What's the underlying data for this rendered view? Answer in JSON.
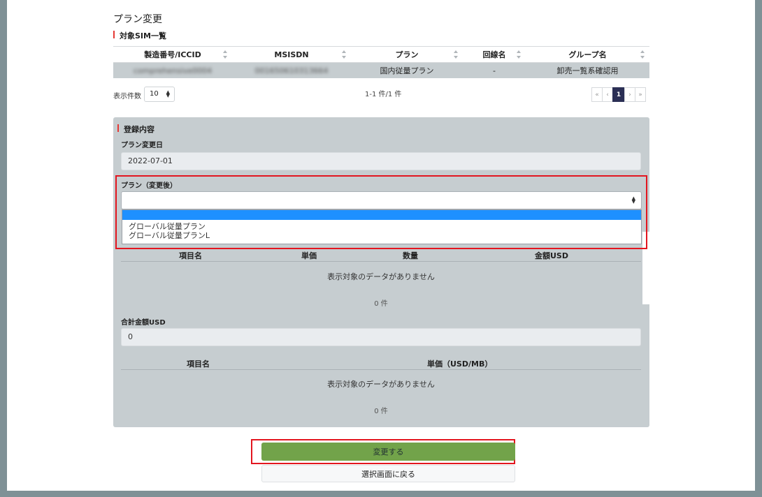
{
  "page": {
    "title": "プラン変更",
    "sim_section_title": "対象SIM一覧"
  },
  "sim_table": {
    "headers": [
      "製造番号/ICCID",
      "MSISDN",
      "プラン",
      "回線名",
      "グループ名"
    ],
    "rows": [
      [
        "comprehensive0004",
        "001650610313664",
        "国内従量プラン",
        "-",
        "卸売一覧系確認用"
      ]
    ]
  },
  "pagination": {
    "per_page_label": "表示件数",
    "per_page_value": "10",
    "count_text": "1-1 件/1 件",
    "first": "«",
    "prev": "‹",
    "current": "1",
    "next": "›",
    "last": "»"
  },
  "registration": {
    "title": "登録内容",
    "change_date_label": "プラン変更日",
    "change_date_value": "2022-07-01",
    "plan_label": "プラン（変更後）",
    "plan_selected": "",
    "plan_options": [
      "",
      "グローバル従量プラン",
      "グローバル従量プランL"
    ],
    "fee_table": {
      "headers": [
        "項目名",
        "単価",
        "数量",
        "金額USD"
      ],
      "empty_message": "表示対象のデータがありません",
      "count": "0 件"
    },
    "total_label": "合計金額USD",
    "total_value": "0",
    "unit_table": {
      "headers": [
        "項目名",
        "単価（USD/MB）"
      ],
      "empty_message": "表示対象のデータがありません",
      "count": "0 件"
    }
  },
  "actions": {
    "submit_label": "変更する",
    "back_label": "選択画面に戻る"
  },
  "colors": {
    "accent_red": "#e3161f",
    "submit_green": "#72a34a",
    "panel_gray": "#c6cdd0",
    "pager_active": "#2b2f55",
    "dropdown_selected": "#1e90ff"
  }
}
